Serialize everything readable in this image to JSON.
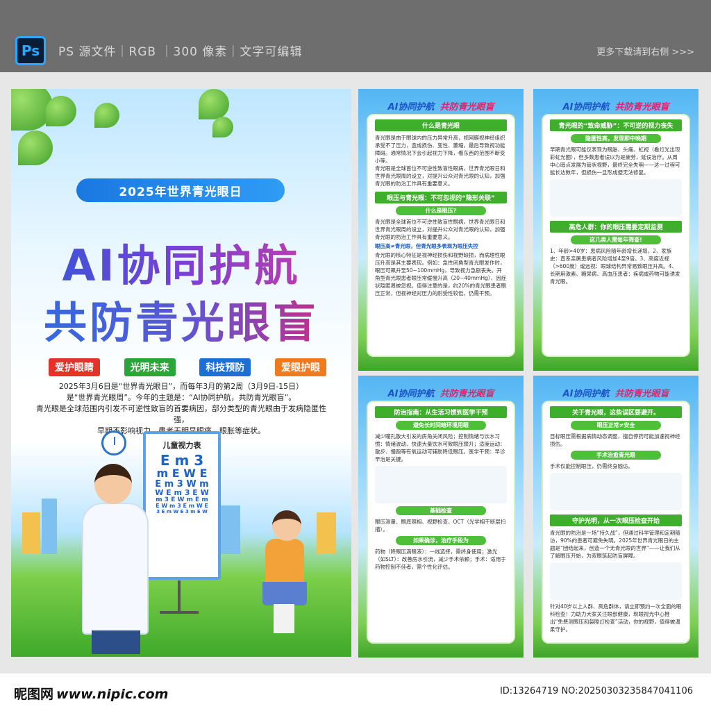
{
  "top": {
    "logo": "Ps",
    "info": "PS 源文件｜RGB ｜300 像素｜文字可编辑",
    "more": "更多下载请到右侧 >>>"
  },
  "poster": {
    "year_badge": "2025年世界青光眼日",
    "title_line1": "AI协同护航",
    "title_line2": "共防青光眼盲",
    "chips": [
      {
        "label": "爱护眼睛",
        "color": "#e4322b"
      },
      {
        "label": "光明未来",
        "color": "#2aa538"
      },
      {
        "label": "科技预防",
        "color": "#1d6fd6"
      },
      {
        "label": "爱眼护眼",
        "color": "#f07a1c"
      }
    ],
    "intro_lines": [
      "2025年3月6日是“世界青光眼日”，而每年3月的第2周（3月9日-15日）",
      "是“世界青光眼周”。今年的主题是：“AI协同护航，共防青光眼盲”。",
      "青光眼是全球范围内引发不可逆性致盲的首要病因，部分类型的青光眼由于发病隐匿性强，",
      "早期不影响视力，患者无明显眼痛、眼胀等症状。"
    ],
    "chart_title": "儿童视力表",
    "chart_rows": [
      "E m 3",
      "m E W E",
      "E m 3 W m",
      "W E m 3 E W",
      "m 3 E W m E m",
      "E W m 3 E m W E",
      "3 E m W E 3 m E W"
    ]
  },
  "panels": [
    {
      "head_a": "AI协同护航",
      "head_b": "共防青光眼盲",
      "sections": [
        {
          "kind": "bar",
          "text": "什么是青光眼"
        },
        {
          "kind": "text",
          "text": "青光眼是由于眼球内的压力异常升高，视网膜视神经组织承受不了压力，造成损伤、变性、萎缩，最后导致视功能障碍。通常情况下会引起视力下降，看东西的范围不断变小等。"
        },
        {
          "kind": "text",
          "text": "青光眼是全球首位不可逆性致盲性眼病，世界青光眼日和世界青光眼周的设立，对提升公众对青光眼的认知，加强青光眼的防治工作具有重要意义。"
        },
        {
          "kind": "bar",
          "text": "眼压与青光眼：不可忽视的“隐形关联”"
        },
        {
          "kind": "small",
          "text": "什么是眼压?"
        },
        {
          "kind": "text",
          "text": "青光眼是全球首位不可逆性致盲性眼病，世界青光眼日和世界青光眼周的设立，对提升公众对青光眼的认知，加强青光眼的防治工作具有重要意义。"
        },
        {
          "kind": "blue",
          "text": "眼压高≠青光眼，但青光眼多表现为眼压失控"
        },
        {
          "kind": "text",
          "text": "青光眼的核心特征是视神经损伤和视野缺损，而病理性眼压升高是其主要表现。例如：急性闭角型青光眼发作时，眼压可飙升至50~100mmHg，导致视力急剧丧失。开角型青光眼患者眼压常缓慢升高（20~40mmHg），因症状隐匿易被忽视。值得注意的是，约20%的青光眼患者眼压正常，但视神经对压力的耐受性较低，仍需干预。"
        }
      ]
    },
    {
      "head_a": "AI协同护航",
      "head_b": "共防青光眼盲",
      "sections": [
        {
          "kind": "bar",
          "text": "青光眼的“致命威胁”：不可逆的视力丧失"
        },
        {
          "kind": "small",
          "text": "隐匿性高，发现即中晚期"
        },
        {
          "kind": "text",
          "text": "早期青光眼可能仅表现为眼胀、头痛、虹视（看灯光出现彩虹光圈），但多数患者误以为是疲劳，延误治疗。从周中心暗点发展为管状视野，最终完全失明——这一过程可能长达数年，但损伤一旦形成便无法修复。"
        },
        {
          "kind": "ill",
          "text": ""
        },
        {
          "kind": "bar",
          "text": "高危人群：你的眼压需要定期监测"
        },
        {
          "kind": "small",
          "text": "这几类人需每年筛查!"
        },
        {
          "kind": "text",
          "text": "1、年龄>40岁：患病风险随年龄增长递增。2、家族史：直系亲属患病者风险增加4至9倍。3、高度近视（>600度）或远视：眼球结构异常易致眼压升高。4、长期用激素、糖尿病、高血压患者：疾病或药物可能诱发青光眼。"
        }
      ]
    },
    {
      "head_a": "AI协同护航",
      "head_b": "共防青光眼盲",
      "sections": [
        {
          "kind": "bar",
          "text": "防治指南：从生活习惯到医学干预"
        },
        {
          "kind": "small",
          "text": "避免长时间暗环境用眼"
        },
        {
          "kind": "text",
          "text": "减少瞳孔散大引发的房角关闭风险；控制情绪与饮水习惯：情绪波动、快速大量饮水可致眼压骤升；适度运动：散步、慢跑等有氧运动可辅助降低眼压。医学干预：早诊早治是关键。"
        },
        {
          "kind": "ill",
          "text": ""
        },
        {
          "kind": "small",
          "text": "基础检查"
        },
        {
          "kind": "text",
          "text": "眼压测量、眼底照相、视野检查、OCT（光学相干断层扫描）。"
        },
        {
          "kind": "small",
          "text": "如果确诊，治疗手段为"
        },
        {
          "kind": "text",
          "text": "药物（降眼压滴眼液）：一线选择，需终身使用；激光（如SLT）：改善房水引流，减少手术依赖；手术：适用于药物控制不佳者，需个性化评估。"
        }
      ]
    },
    {
      "head_a": "AI协同护航",
      "head_b": "共防青光眼盲",
      "sections": [
        {
          "kind": "bar",
          "text": "关于青光眼，这些误区要避开。"
        },
        {
          "kind": "small",
          "text": "眼压正常≠安全"
        },
        {
          "kind": "text",
          "text": "目标眼压需根据病情动态调整，擅自停药可能加速视神经损伤。"
        },
        {
          "kind": "small",
          "text": "手术治愈青光眼"
        },
        {
          "kind": "text",
          "text": "手术仅能控制眼压，仍需终身随访。"
        },
        {
          "kind": "ill",
          "text": ""
        },
        {
          "kind": "bar",
          "text": "守护光明，从一次眼压检查开始"
        },
        {
          "kind": "text",
          "text": "青光眼的防治是一场“持久战”，但通过科学管理和定期随访，90%的患者可避免失明。2025年世界青光眼日的主题是“团结起来，创造一个无青光眼的世界”——让我们从了解眼压开始，为双眼筑起防盲屏障。"
        },
        {
          "kind": "ill",
          "text": ""
        },
        {
          "kind": "text",
          "text": "针对40岁以上人群、高危群体，请立即预约一次全面的眼科检查！力助力大家关注眼部健康，现眼视光中心推出“免费测眼压和裂隙灯检查”活动，你的视野，值得被温柔守护。"
        }
      ]
    }
  ],
  "bottom": {
    "site": "昵图网",
    "url": "www.nipic.com",
    "id_text": "ID:13264719 NO:20250303235847041106"
  }
}
